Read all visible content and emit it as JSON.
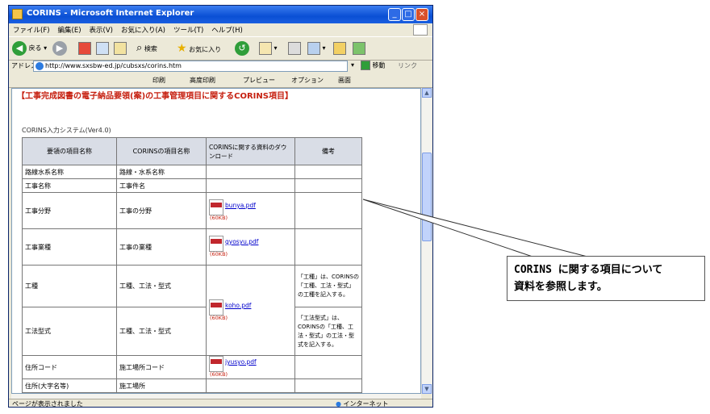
{
  "window": {
    "title": "CORINS - Microsoft Internet Explorer",
    "controls": {
      "minimize": "_",
      "maximize": "□",
      "close": "×"
    }
  },
  "menubar": {
    "items": [
      "ファイル(F)",
      "編集(E)",
      "表示(V)",
      "お気に入り(A)",
      "ツール(T)",
      "ヘルプ(H)"
    ]
  },
  "toolbar": {
    "back_label": "戻る",
    "search_label": "検索",
    "favorites_label": "お気に入り"
  },
  "addressbar": {
    "label": "アドレス(D)",
    "url": "http://www.sxsbw-ed.jp/cubsxs/corins.htm",
    "go_label": "移動",
    "links_label": "リンク"
  },
  "linksbar": {
    "print_label": "印刷",
    "print_preview_label": "高度印刷",
    "preview_label": "プレビュー",
    "options_label": "オプション",
    "screen_label": "画面"
  },
  "page": {
    "heading": "【工事完成図書の電子納品要領(案)の工事管理項目に関するCORINS項目】",
    "subtitle": "CORINS入力システム(Ver4.0)",
    "columns": [
      "要領の項目名称",
      "CORINSの項目名称",
      "CORINSに関する資料のダウンロード",
      "備考"
    ],
    "rows": [
      {
        "item": "路線水系名称",
        "corins": "路線・水系名称",
        "remark": ""
      },
      {
        "item": "工事名称",
        "corins": "工事件名",
        "remark": ""
      },
      {
        "item": "工事分野",
        "corins": "工事の分野",
        "pdf": {
          "name": "bunya.pdf",
          "size": "(60KB)"
        },
        "remark": ""
      },
      {
        "item": "工事業種",
        "corins": "工事の業種",
        "pdf": {
          "name": "gyosyu.pdf",
          "size": "(60KB)"
        },
        "remark": ""
      },
      {
        "item": "工種",
        "corins": "工種、工法・型式",
        "remark": "「工種」は、CORINSの「工種、工法・型式」の工種を記入する。"
      },
      {
        "item": "工法型式",
        "corins": "工種、工法・型式",
        "remark": "「工法型式」は、CORINSの「工種、工法・型式」の工法・型式を記入する。"
      },
      {
        "item": "住所コード",
        "corins": "施工場所コード",
        "pdf": {
          "name": "jyusyo.pdf",
          "size": "(60KB)"
        },
        "remark": ""
      },
      {
        "item": "住所(大字名等)",
        "corins": "施工場所",
        "remark": ""
      }
    ],
    "koshu_pdf": {
      "name": "koho.pdf",
      "size": "(60KB)"
    }
  },
  "statusbar": {
    "status": "ページが表示されました",
    "zone": "インターネット"
  },
  "callout": {
    "line1": "CORINS に関する項目について",
    "line2": "資料を参照します。"
  },
  "colors": {
    "heading": "#c62010",
    "titlebar": "#0a4fd4",
    "link": "#0000cc"
  }
}
